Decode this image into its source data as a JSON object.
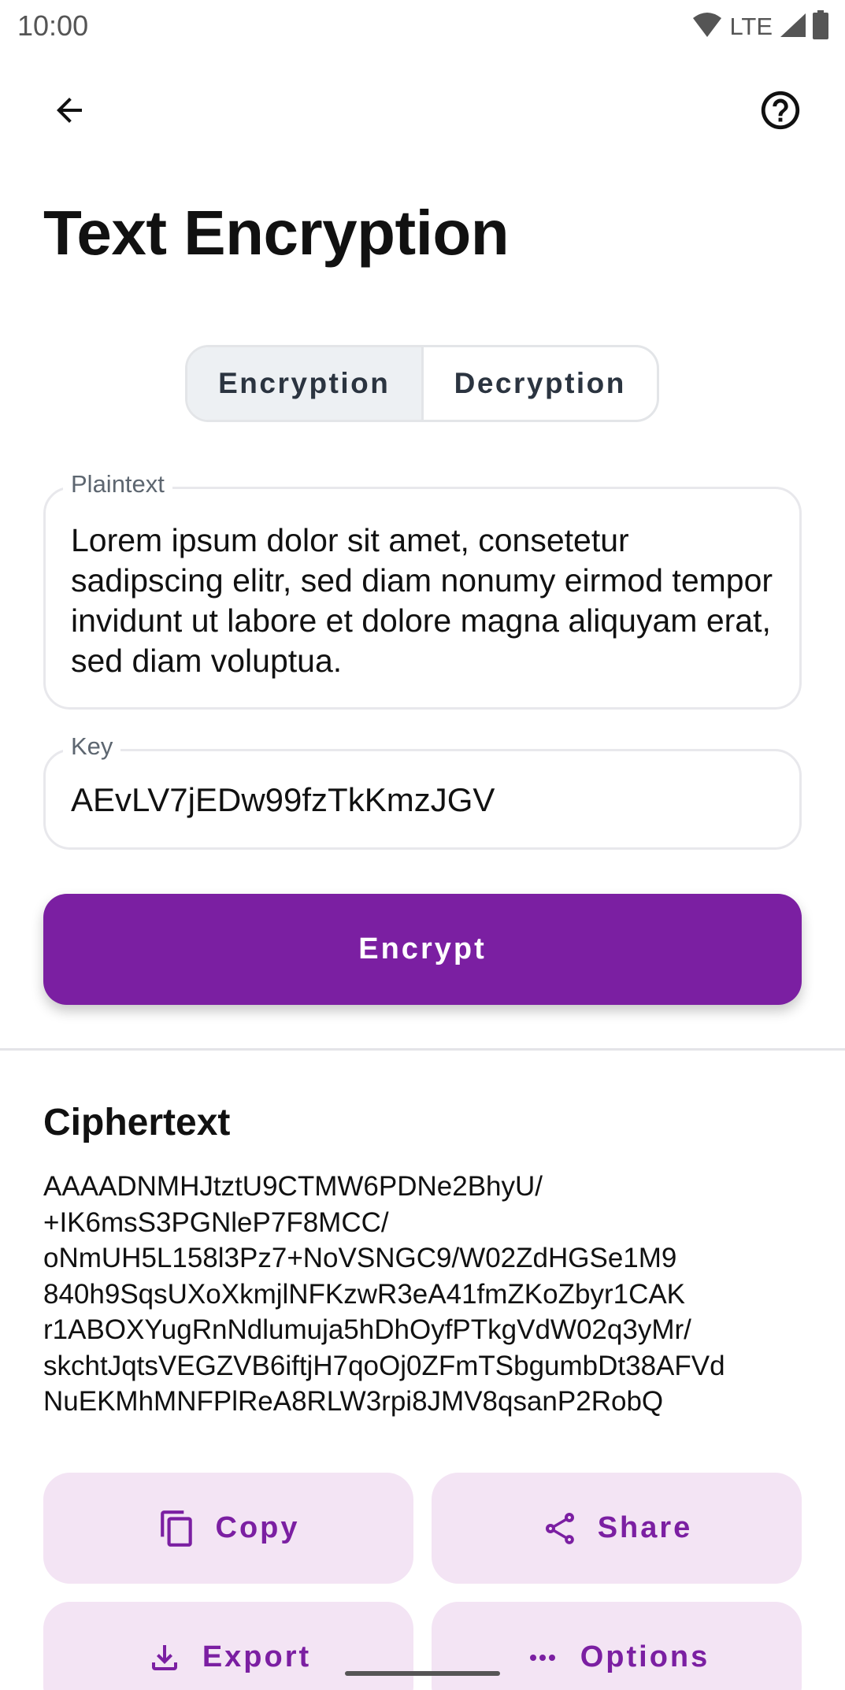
{
  "status_bar": {
    "time": "10:00",
    "network": "LTE",
    "icons": [
      "wifi-icon",
      "cell-signal-icon",
      "battery-icon"
    ]
  },
  "top_bar": {
    "back_icon": "arrow-back-icon",
    "help_icon": "help-circle-icon"
  },
  "page": {
    "title": "Text Encryption"
  },
  "mode_tabs": [
    {
      "label": "Encryption",
      "selected": true
    },
    {
      "label": "Decryption",
      "selected": false
    }
  ],
  "plaintext_field": {
    "label": "Plaintext",
    "value": "Lorem ipsum dolor sit amet, consetetur sadipscing elitr, sed diam nonumy eirmod tempor invidunt ut labore et dolore magna aliquyam erat, sed diam voluptua."
  },
  "key_field": {
    "label": "Key",
    "value": "AEvLV7jEDw99fzTkKmzJGV"
  },
  "encrypt_button": {
    "label": "Encrypt"
  },
  "ciphertext": {
    "heading": "Ciphertext",
    "lines": [
      "AAAADNMHJtztU9CTMW6PDNe2BhyU/",
      "+IK6msS3PGNleP7F8MCC/",
      "oNmUH5L158l3Pz7+NoVSNGC9/W02ZdHGSe1M9",
      "840h9SqsUXoXkmjlNFKzwR3eA41fmZKoZbyr1CAK",
      "r1ABOXYugRnNdlumuja5hDhOyfPTkgVdW02q3yMr/",
      "skchtJqtsVEGZVB6iftjH7qoOj0ZFmTSbgumbDt38AFVd",
      "NuEKMhMNFPlReA8RLW3rpi8JMV8qsanP2RobQ"
    ]
  },
  "actions": [
    {
      "label": "Copy",
      "icon": "copy-icon"
    },
    {
      "label": "Share",
      "icon": "share-icon"
    },
    {
      "label": "Export",
      "icon": "download-icon"
    },
    {
      "label": "Options",
      "icon": "more-horiz-icon"
    }
  ],
  "colors": {
    "accent": "#7b1fa2",
    "tonal_button_bg": "#f3e4f4",
    "segment_selected_bg": "#edf0f3"
  }
}
